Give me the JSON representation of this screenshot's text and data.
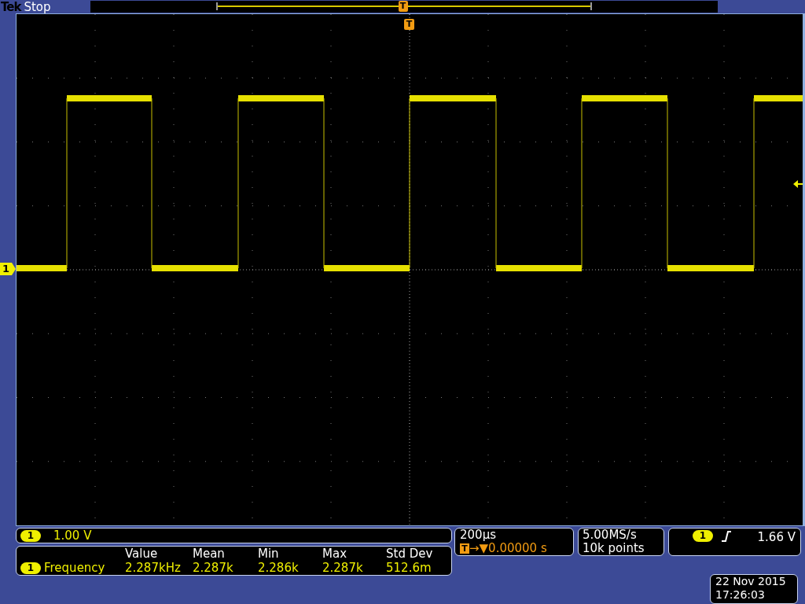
{
  "header": {
    "brand": "Tek",
    "status": "Stop",
    "record_trigger_label": "T"
  },
  "display": {
    "trigger_position_label": "T",
    "channel_marker": "1"
  },
  "channel": {
    "number": "1",
    "scale": "1.00 V"
  },
  "measurement": {
    "columns": [
      "Value",
      "Mean",
      "Min",
      "Max",
      "Std Dev"
    ],
    "rows": [
      {
        "channel": "1",
        "name": "Frequency",
        "values": [
          "2.287kHz",
          "2.287k",
          "2.286k",
          "2.287k",
          "512.6m"
        ]
      }
    ]
  },
  "timebase": {
    "scale": "200µs",
    "trigger_label": "T",
    "delay_marker": "→▼",
    "delay": "0.00000 s"
  },
  "acquisition": {
    "sample_rate": "5.00MS/s",
    "record_length": "10k points"
  },
  "trigger": {
    "channel": "1",
    "kind": "rising",
    "level": "1.66 V"
  },
  "datetime": {
    "date": "22 Nov 2015",
    "time": "17:26:03"
  }
}
